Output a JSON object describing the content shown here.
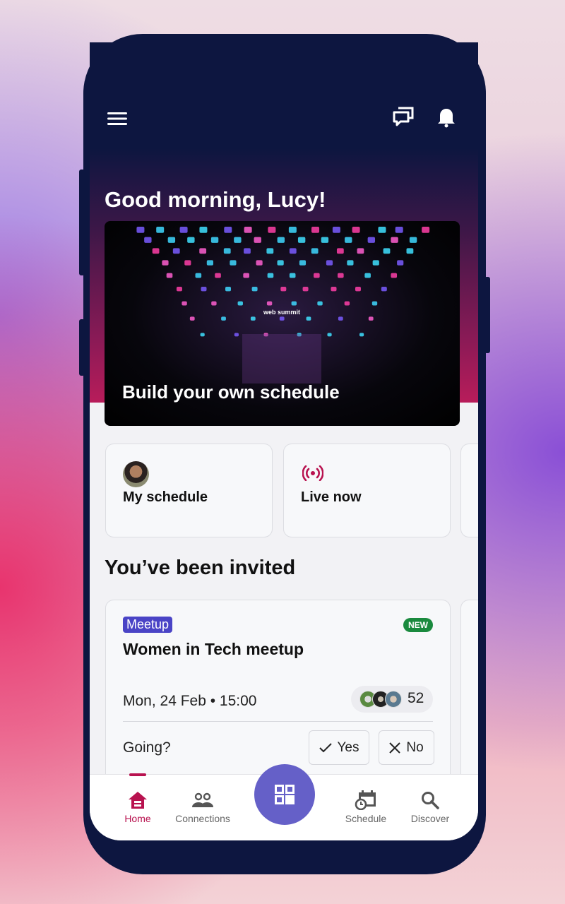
{
  "header": {
    "greeting": "Good morning, Lucy!"
  },
  "banner": {
    "title": "Build your own schedule",
    "logo_text": "web summit"
  },
  "quick_links": [
    {
      "label": "My schedule",
      "icon": "avatar"
    },
    {
      "label": "Live now",
      "icon": "live-broadcast-icon"
    }
  ],
  "invites": {
    "title": "You’ve been invited",
    "event": {
      "tag": "Meetup",
      "badge": "NEW",
      "title": "Women in Tech meetup",
      "date": "Mon, 24 Feb • 15:00",
      "attendee_count": "52",
      "going_label": "Going?",
      "yes_label": "Yes",
      "no_label": "No"
    }
  },
  "nav": {
    "items": [
      {
        "label": "Home",
        "active": true
      },
      {
        "label": "Connections"
      },
      {
        "label": "Schedule"
      },
      {
        "label": "Discover"
      }
    ]
  },
  "colors": {
    "accent": "#b8124f",
    "fab": "#6560c8",
    "tag": "#4a44c6",
    "new_badge": "#1a8a3e",
    "header": "#0d1640"
  }
}
